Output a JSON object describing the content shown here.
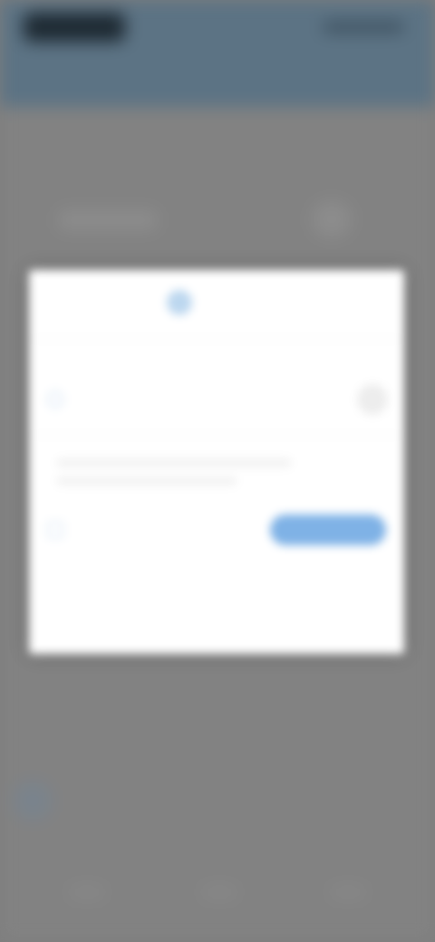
{
  "status_bar": {
    "time": "",
    "icons": [
      "signal-icon",
      "wifi-icon",
      "battery-icon"
    ]
  },
  "background": {
    "note_bg": "",
    "fab_icon": "add-icon",
    "nav_icons": [
      "home-icon",
      "search-icon",
      "profile-icon"
    ]
  },
  "dialog": {
    "title": "",
    "logo_icon": "brand-logo-icon",
    "option": {
      "label": "",
      "sublabel": ""
    },
    "consent_label": "",
    "continue_label": ""
  },
  "colors": {
    "accent": "#7fb2e6",
    "status_bar": "#5c7384",
    "scrim": "#7e7e7e",
    "dialog_bg": "#ffffff"
  }
}
